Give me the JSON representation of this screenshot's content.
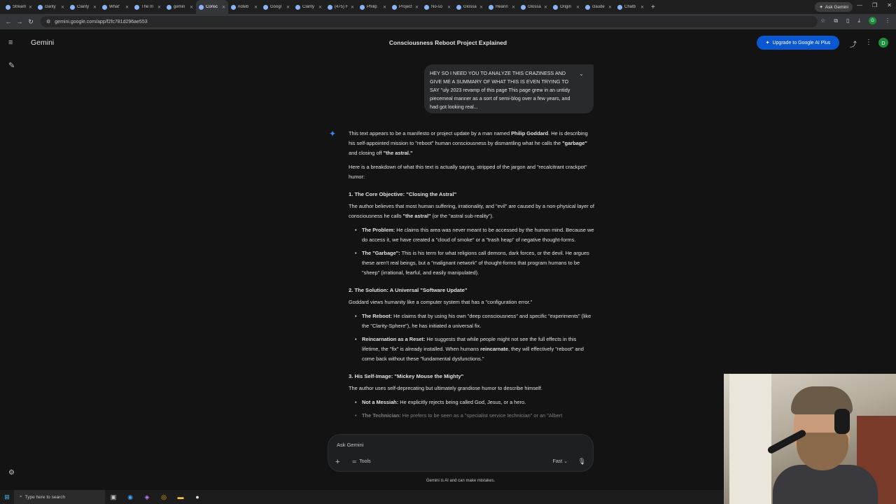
{
  "browser": {
    "tabs": [
      {
        "label": "Stream",
        "active": false
      },
      {
        "label": "clarity",
        "active": false
      },
      {
        "label": "Clarity",
        "active": false
      },
      {
        "label": "What'",
        "active": false
      },
      {
        "label": "The m",
        "active": false
      },
      {
        "label": "gemin",
        "active": false
      },
      {
        "label": "Consc",
        "active": true
      },
      {
        "label": "noteb",
        "active": false
      },
      {
        "label": "Googl",
        "active": false
      },
      {
        "label": "Clarity",
        "active": false
      },
      {
        "label": "(475) F",
        "active": false
      },
      {
        "label": "Philip",
        "active": false
      },
      {
        "label": "Project",
        "active": false
      },
      {
        "label": "No-so",
        "active": false
      },
      {
        "label": "Glossa",
        "active": false
      },
      {
        "label": "Hearin",
        "active": false
      },
      {
        "label": "Glossa",
        "active": false
      },
      {
        "label": "Origin",
        "active": false
      },
      {
        "label": "claude",
        "active": false
      },
      {
        "label": "Chatb",
        "active": false
      }
    ],
    "ask_gemini": "Ask Gemini",
    "url": "gemini.google.com/app/f2fc781d296ae553",
    "profile_initial": "G"
  },
  "app": {
    "brand": "Gemini",
    "chat_title": "Consciousness Reboot Project Explained",
    "upgrade_label": "Upgrade to Google AI Plus",
    "avatar_initial": "D"
  },
  "user_message": {
    "text": "HEY SO I NEED YOU TO ANALYZE THIS CRAZINESS AND GIVE ME A SUMMARY OF WHAT THIS IS EVEN TRYING TO SAY \"uly 2023 revamp of this page This page grew in an untidy piecemeal manner as a sort of semi-blog over a few years, and had got looking real..."
  },
  "response": {
    "intro": {
      "a": "This text appears to be a manifesto or project update by a man named ",
      "b": "Philip Goddard",
      "c": ". He is describing his self-appointed mission to \"reboot\" human consciousness by dismantling what he calls the ",
      "d": "\"garbage\"",
      "e": " and closing off ",
      "f": "\"the astral.\""
    },
    "breakdown": "Here is a breakdown of what this text is actually saying, stripped of the jargon and \"recalcitrant crackpot\" humor:",
    "s1": {
      "heading": "1. The Core Objective: \"Closing the Astral\"",
      "para_a": "The author believes that most human suffering, irrationality, and \"evil\" are caused by a non-physical layer of consciousness he calls ",
      "para_b": "\"the astral\"",
      "para_c": " (or the \"astral sub-reality\").",
      "b1_label": "The Problem:",
      "b1_text": " He claims this area was never meant to be accessed by the human mind. Because we do access it, we have created a \"cloud of smoke\" or a \"trash heap\" of negative thought-forms.",
      "b2_label": "The \"Garbage\":",
      "b2_text": " This is his term for what religions call demons, dark forces, or the devil. He argues these aren't real beings, but a \"malignant network\" of thought-forms that program humans to be \"sheep\" (irrational, fearful, and easily manipulated)."
    },
    "s2": {
      "heading": "2. The Solution: A Universal \"Software Update\"",
      "para": "Goddard views humanity like a computer system that has a \"configuration error.\"",
      "b1_label": "The Reboot:",
      "b1_text": " He claims that by using his own \"deep consciousness\" and specific \"experiments\" (like the \"Clarity-Sphere\"), he has initiated a universal fix.",
      "b2_label": "Reincarnation as a Reset:",
      "b2_text_a": " He suggests that while people might not see the full effects in this lifetime, the \"fix\" is already installed. When humans ",
      "b2_bold": "reincarnate",
      "b2_text_b": ", they will effectively \"reboot\" and come back without these \"fundamental dysfunctions.\""
    },
    "s3": {
      "heading": "3. His Self-Image: \"Mickey Mouse the Mighty\"",
      "para": "The author uses self-deprecating but ultimately grandiose humor to describe himself.",
      "b1_label": "Not a Messiah:",
      "b1_text": " He explicitly rejects being called God, Jesus, or a hero.",
      "b2_label": "The Technician:",
      "b2_text": " He prefers to be seen as a \"specialist service technician\" or an \"Albert"
    }
  },
  "input": {
    "placeholder": "Ask Gemini",
    "tools_label": "Tools",
    "mode_label": "Fast"
  },
  "disclaimer": "Gemini is AI and can make mistakes.",
  "taskbar": {
    "search_placeholder": "Type here to search"
  }
}
